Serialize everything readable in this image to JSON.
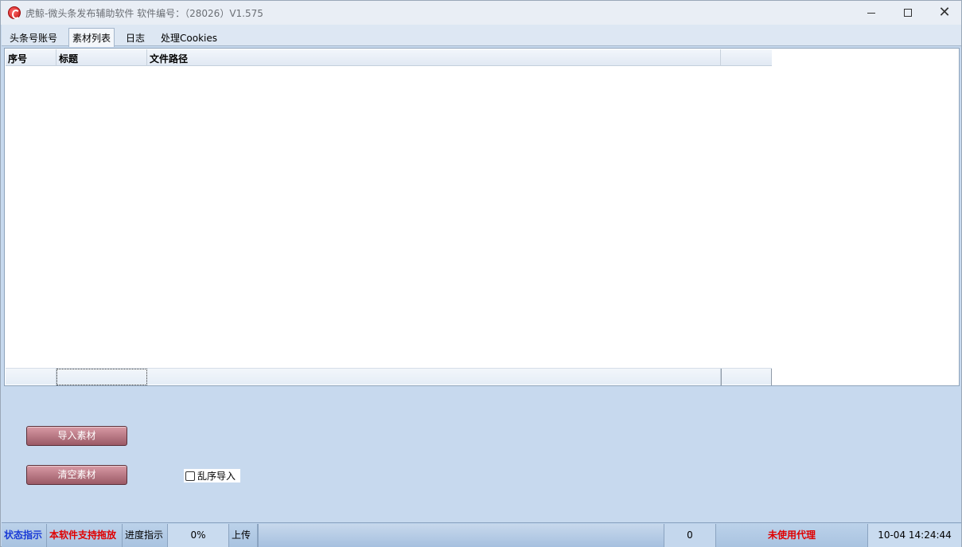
{
  "window": {
    "title": "虎鲸-微头条发布辅助软件 软件编号：（28026）V1.575",
    "controls": {
      "minimize": "minimize-icon",
      "maximize": "maximize-icon",
      "close": "close-icon"
    }
  },
  "tabs": [
    {
      "label": "头条号账号",
      "active": false
    },
    {
      "label": "素材列表",
      "active": true
    },
    {
      "label": "日志",
      "active": false
    },
    {
      "label": "处理Cookies",
      "active": false
    }
  ],
  "table": {
    "columns": [
      "序号",
      "标题",
      "文件路径",
      ""
    ],
    "rows": []
  },
  "actions": {
    "import_label": "导入素材",
    "clear_label": "清空素材",
    "shuffle_label": "乱序导入",
    "shuffle_checked": false
  },
  "statusbar": {
    "status_label": "状态指示",
    "drag_support": "本软件支持拖放",
    "progress_label": "进度指示",
    "progress_value": "0%",
    "upload_label": "上传",
    "count": "0",
    "proxy_status": "未使用代理",
    "datetime": "10-04  14:24:44"
  },
  "colors": {
    "button_bg": "#b07480",
    "status_blue": "#1a3bd6",
    "status_red": "#e00000",
    "window_bg": "#c7d9ee"
  }
}
